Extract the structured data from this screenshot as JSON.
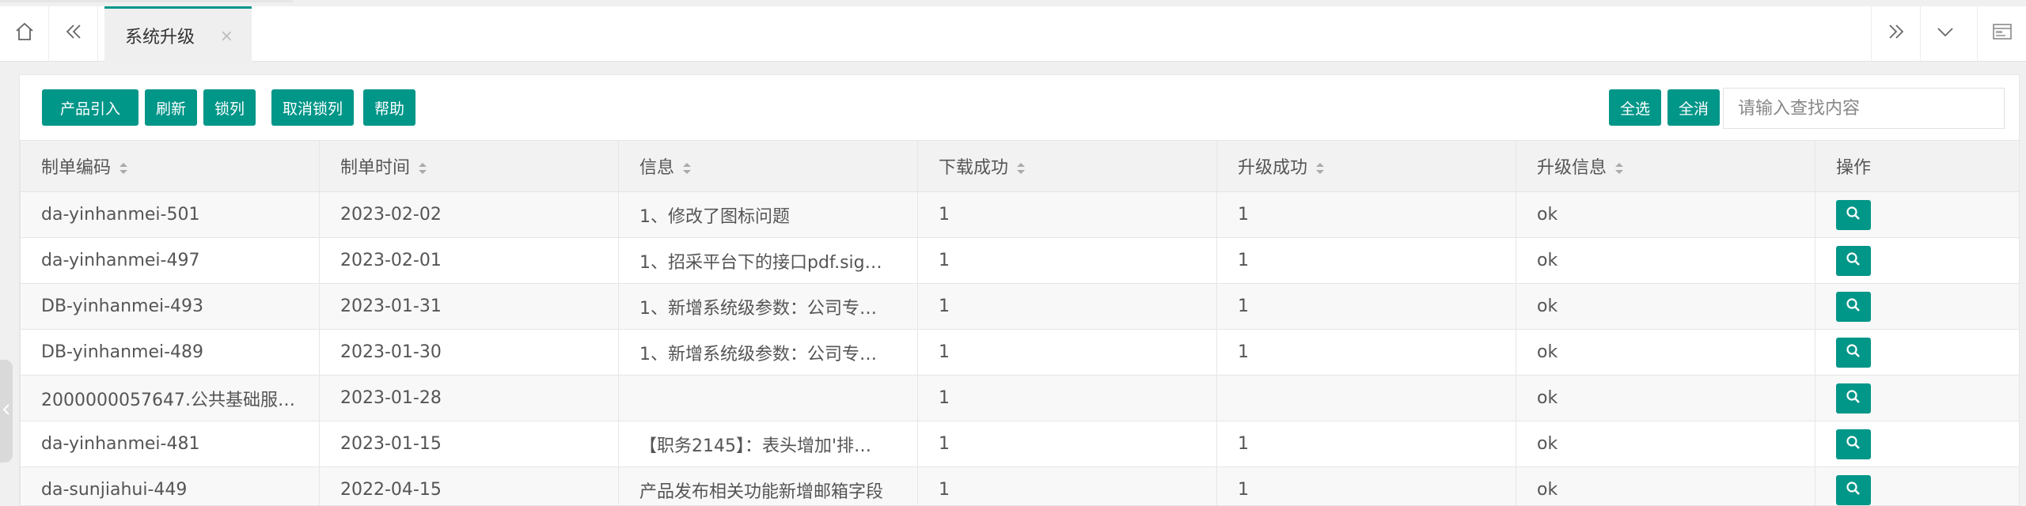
{
  "tabs": {
    "active_tab": "系统升级",
    "close_glyph": "×"
  },
  "toolbar": {
    "buttons": [
      "产品引入",
      "刷新",
      "锁列",
      "取消锁列",
      "帮助"
    ],
    "select_all_label": "全选",
    "clear_selection_label": "全消",
    "search_placeholder": "请输入查找内容"
  },
  "table": {
    "columns": [
      "制单编码",
      "制单时间",
      "信息",
      "下载成功",
      "升级成功",
      "升级信息",
      "操作"
    ],
    "rows": [
      {
        "code": "da-yinhanmei-501",
        "date": "2023-02-02",
        "info": "1、修改了图标问题",
        "download": "1",
        "upgrade": "1",
        "upgrade_info": "ok"
      },
      {
        "code": "da-yinhanmei-497",
        "date": "2023-02-01",
        "info": "1、招采平台下的接口pdf.sig…",
        "download": "1",
        "upgrade": "1",
        "upgrade_info": "ok"
      },
      {
        "code": "DB-yinhanmei-493",
        "date": "2023-01-31",
        "info": "1、新增系统级参数：公司专…",
        "download": "1",
        "upgrade": "1",
        "upgrade_info": "ok"
      },
      {
        "code": "DB-yinhanmei-489",
        "date": "2023-01-30",
        "info": "1、新增系统级参数：公司专…",
        "download": "1",
        "upgrade": "1",
        "upgrade_info": "ok"
      },
      {
        "code": "2000000057647.公共基础服…",
        "date": "2023-01-28",
        "info": "",
        "download": "1",
        "upgrade": "",
        "upgrade_info": "ok"
      },
      {
        "code": "da-yinhanmei-481",
        "date": "2023-01-15",
        "info": "【职务2145】：表头增加'排…",
        "download": "1",
        "upgrade": "1",
        "upgrade_info": "ok"
      },
      {
        "code": "da-sunjiahui-449",
        "date": "2022-04-15",
        "info": "产品发布相关功能新增邮箱字段",
        "download": "1",
        "upgrade": "1",
        "upgrade_info": "ok"
      }
    ]
  },
  "icons": {
    "home": "home-icon",
    "prev": "double-chevron-left-icon",
    "next": "double-chevron-right-icon",
    "dropdown": "chevron-down-icon",
    "window": "window-icon",
    "view": "search-icon"
  },
  "colors": {
    "accent": "#009688",
    "header_bg": "#f2f2f2",
    "stripe_bg": "#f8f8f8"
  }
}
